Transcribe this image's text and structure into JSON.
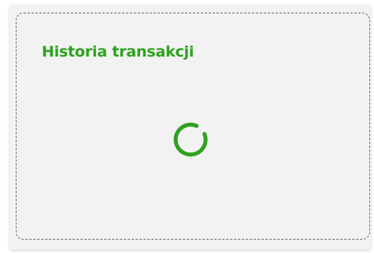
{
  "widget": {
    "title": "Historia transakcji",
    "status": "loading",
    "accent_color": "#2ea11e",
    "spinner_icon": "loading-spinner-icon"
  }
}
